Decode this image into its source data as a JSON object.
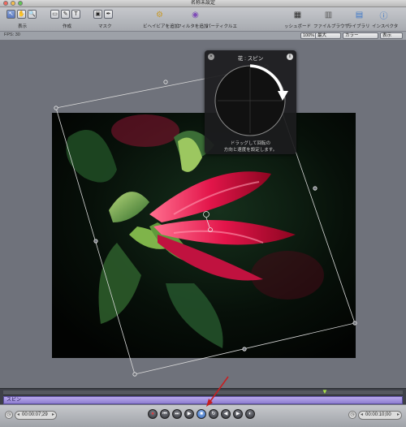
{
  "window": {
    "title": "名称未設定"
  },
  "toolbar": {
    "group_display_label": "表示",
    "group_create_label": "作成",
    "group_mask_label": "マスク",
    "behavior_label": "ビヘイビアを追加",
    "filter_label": "フィルタを追加",
    "particle_label": "パーティクルエ",
    "dashboard_label": "ッシュボード",
    "browser_label": "ファイルブラウザ",
    "library_label": "ライブラリ",
    "inspector_label": "インスペクタ"
  },
  "options_bar": {
    "fps": "FPS: 30",
    "zoom_value": "100%",
    "view_value": "最大",
    "color_value": "カラー",
    "display_value": "表示"
  },
  "hud": {
    "title": "花 : スピン",
    "hint_line1": "ドラッグして回転の",
    "hint_line2": "方向と速度を設定します。"
  },
  "timeline": {
    "track_label": "スピン"
  },
  "transport": {
    "current_time": "00:00:07;29",
    "duration": "00:00:10;00"
  },
  "colors": {
    "accent": "#3467b7",
    "track": "#a796e0",
    "record": "#e2363a",
    "callout_arrow": "#c61f22"
  }
}
